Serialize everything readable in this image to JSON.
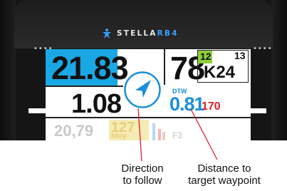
{
  "brand": {
    "name_primary": "STELLA",
    "name_accent": "RB4"
  },
  "screen": {
    "main_value": "21.83",
    "secondary_value": "1.08",
    "right_big_value": "78",
    "waypoint_index_green": "12",
    "waypoint_index": "13",
    "waypoint_name": "K24",
    "dtw_label": "DTW",
    "dtw_value": "0.81",
    "dtw_extra_value": "170",
    "faded_value": "20,79",
    "faded_yellow_value": "127",
    "faded_yellow_label": "Moy",
    "faded_tail": "F3"
  },
  "callouts": {
    "direction_line1": "Direction",
    "direction_line2": "to follow",
    "distance_line1": "Distance to",
    "distance_line2": "target waypoint"
  },
  "colors": {
    "accent_blue": "#1aa7e6",
    "dtw_blue": "#1a8fd9",
    "waypoint_green": "#8dd13a",
    "extra_red": "#e0202a",
    "callout_line": "#e0202a"
  },
  "icons": {
    "compass": "navigation-arrow-icon",
    "logo": "stella-logo-icon"
  }
}
